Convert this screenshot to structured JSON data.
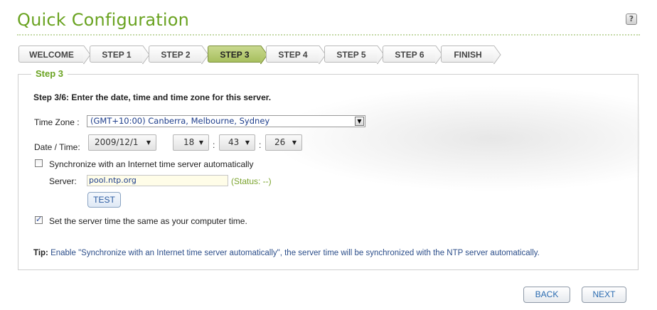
{
  "header": {
    "title": "Quick Configuration",
    "help_icon": "?"
  },
  "steps": [
    {
      "label": "WELCOME",
      "active": false
    },
    {
      "label": "STEP 1",
      "active": false
    },
    {
      "label": "STEP 2",
      "active": false
    },
    {
      "label": "STEP 3",
      "active": true
    },
    {
      "label": "STEP 4",
      "active": false
    },
    {
      "label": "STEP 5",
      "active": false
    },
    {
      "label": "STEP 6",
      "active": false
    },
    {
      "label": "FINISH",
      "active": false
    }
  ],
  "section": {
    "legend": "Step 3",
    "instruction": "Step 3/6: Enter the date, time and time zone for this server."
  },
  "timezone": {
    "label": "Time Zone :",
    "value": "(GMT+10:00) Canberra, Melbourne, Sydney"
  },
  "datetime": {
    "label": "Date / Time:",
    "date": "2009/12/1",
    "hour": "18",
    "minute": "43",
    "second": "26",
    "separator": ":"
  },
  "ntp": {
    "sync_label": "Synchronize with an Internet time server automatically",
    "sync_checked": false,
    "server_label": "Server:",
    "server_value": "pool.ntp.org",
    "status": "(Status: --)",
    "test_label": "TEST"
  },
  "pc_time": {
    "label": "Set the server time the same as your computer time.",
    "checked": true
  },
  "tip": {
    "prefix": "Tip:",
    "text": " Enable \"Synchronize with an Internet time server automatically\", the server time will be synchronized with the NTP server automatically."
  },
  "footer": {
    "back_label": "BACK",
    "next_label": "NEXT"
  },
  "colors": {
    "brand_green": "#6aa321",
    "active_step": "#b3c86e",
    "link_blue": "#2a6bb0"
  }
}
